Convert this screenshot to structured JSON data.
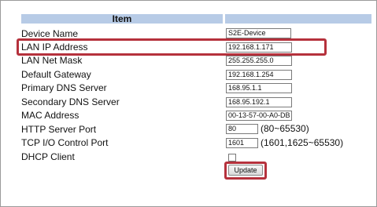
{
  "table": {
    "header": "Item",
    "rows": [
      {
        "label": "Device Name",
        "value": "S2E-Device"
      },
      {
        "label": "LAN IP Address",
        "value": "192.168.1.171"
      },
      {
        "label": "LAN Net Mask",
        "value": "255.255.255.0"
      },
      {
        "label": "Default Gateway",
        "value": "192.168.1.254"
      },
      {
        "label": "Primary DNS Server",
        "value": "168.95.1.1"
      },
      {
        "label": "Secondary DNS Server",
        "value": "168.95.192.1"
      },
      {
        "label": "MAC Address",
        "value": "00-13-57-00-A0-DB"
      },
      {
        "label": "HTTP Server Port",
        "value": "80",
        "hint": "(80~65530)"
      },
      {
        "label": "TCP I/O Control Port",
        "value": "1601",
        "hint": "(1601,1625~65530)"
      },
      {
        "label": "DHCP Client"
      }
    ]
  },
  "update_button": "Update",
  "colors": {
    "header_bg": "#b7cbe6",
    "highlight": "#b5313c"
  }
}
